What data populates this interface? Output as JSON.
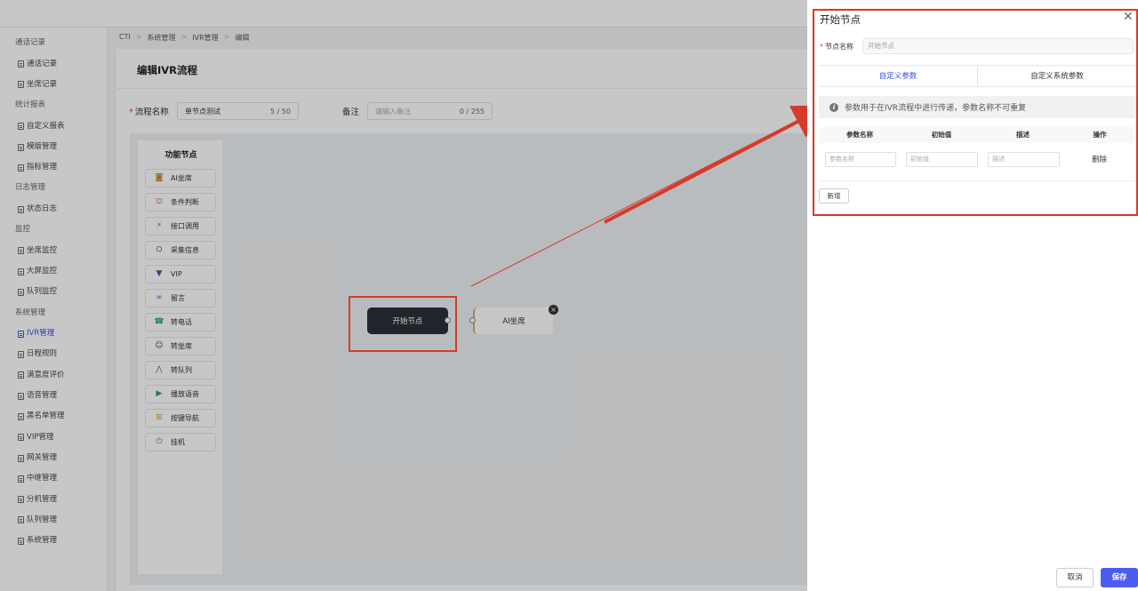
{
  "sidebar": {
    "sections": [
      {
        "label": "通话记录",
        "items": [
          "通话记录",
          "坐席记录"
        ]
      },
      {
        "label": "统计报表",
        "items": [
          "自定义报表",
          "模版管理",
          "指标管理"
        ]
      },
      {
        "label": "日志管理",
        "items": [
          "状态日志"
        ]
      },
      {
        "label": "监控",
        "items": [
          "坐席监控",
          "大屏监控",
          "队列监控"
        ]
      },
      {
        "label": "系统管理",
        "items": [
          "IVR管理",
          "日程规则",
          "满意度评价",
          "语音管理",
          "黑名单管理",
          "VIP管理",
          "网关管理",
          "中继管理",
          "分机管理",
          "队列管理",
          "系统管理"
        ]
      }
    ],
    "active_item": "IVR管理"
  },
  "breadcrumb": [
    "CTI",
    "系统管理",
    "IVR管理",
    "编辑"
  ],
  "page_title": "编辑IVR流程",
  "form": {
    "flow_name_label": "流程名称",
    "flow_name_value": "单节点测试",
    "flow_name_count": "5 / 50",
    "remark_label": "备注",
    "remark_placeholder": "请输入备注",
    "remark_count": "0 / 255"
  },
  "palette": {
    "title": "功能节点",
    "items": [
      {
        "label": "AI坐席",
        "icon": "robot-icon",
        "color": "#c8862a"
      },
      {
        "label": "条件判断",
        "icon": "branch-icon",
        "color": "#c0392b"
      },
      {
        "label": "接口调用",
        "icon": "plug-icon",
        "color": "#8e44ad"
      },
      {
        "label": "采集信息",
        "icon": "collect-icon",
        "color": "#7b4fb5"
      },
      {
        "label": "VIP",
        "icon": "vip-icon",
        "color": "#6c3fb0"
      },
      {
        "label": "留言",
        "icon": "voicemail-icon",
        "color": "#2a6fd6"
      },
      {
        "label": "转电话",
        "icon": "phone-icon",
        "color": "#2a9d6e"
      },
      {
        "label": "转坐席",
        "icon": "user-icon",
        "color": "#444444"
      },
      {
        "label": "转队列",
        "icon": "queue-icon",
        "color": "#2aa58a"
      },
      {
        "label": "播放语音",
        "icon": "play-icon",
        "color": "#27a15a"
      },
      {
        "label": "按键导航",
        "icon": "keypad-icon",
        "color": "#e0a020"
      },
      {
        "label": "挂机",
        "icon": "power-icon",
        "color": "#7b4fb5"
      }
    ]
  },
  "canvas": {
    "start_node": "开始节点",
    "ai_node": "AI坐席"
  },
  "drawer": {
    "title": "开始节点",
    "node_name_label": "节点名称",
    "node_name_value": "开始节点",
    "tabs": [
      "自定义参数",
      "自定义系统参数"
    ],
    "active_tab": 0,
    "notice": "参数用于在IVR流程中进行传递，参数名称不可重复",
    "table_headers": [
      "参数名称",
      "初始值",
      "描述",
      "操作"
    ],
    "row_placeholders": [
      "参数名称",
      "初始值",
      "描述"
    ],
    "delete_label": "删除",
    "add_label": "新增",
    "cancel_label": "取消",
    "save_label": "保存"
  },
  "colors": {
    "primary": "#4a5cf0",
    "highlight": "#d63a2a"
  }
}
